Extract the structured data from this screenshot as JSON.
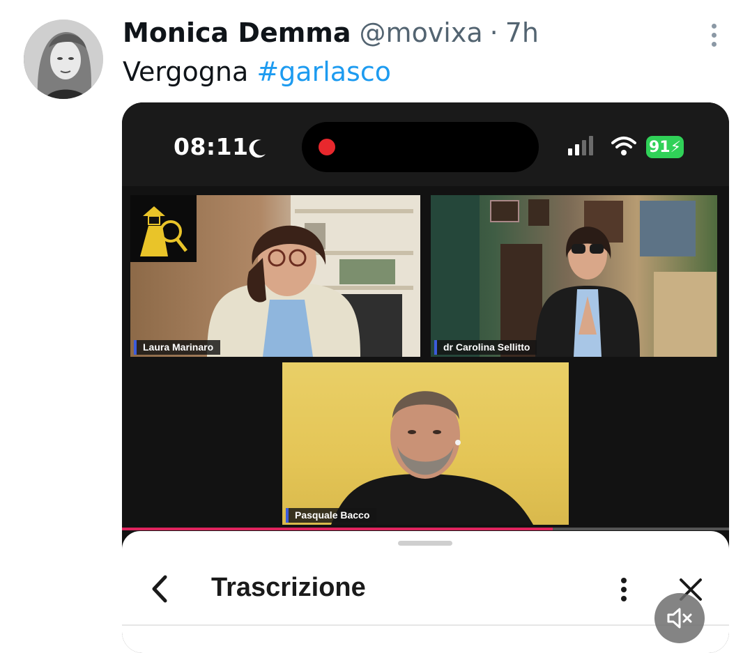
{
  "tweet": {
    "author_name": "Monica Demma",
    "author_handle": "@movixa",
    "separator": "·",
    "time": "7h",
    "text_plain": "Vergogna",
    "hashtag": "#garlasco"
  },
  "video": {
    "status_bar": {
      "clock": "08:11",
      "battery": "91"
    },
    "participants": [
      {
        "name": "Laura Marinaro"
      },
      {
        "name": "dr Carolina Sellitto"
      },
      {
        "name": "Pasquale Bacco"
      }
    ],
    "progress_fraction": 0.71,
    "sheet": {
      "title": "Trascrizione"
    }
  },
  "icons": {
    "more": "more-vertical-icon",
    "moon": "moon-icon",
    "signal": "signal-icon",
    "wifi": "wifi-icon",
    "back": "chevron-left-icon",
    "kebab": "kebab-icon",
    "close": "close-icon",
    "mute": "speaker-muted-icon"
  },
  "colors": {
    "link": "#1d9bf0",
    "battery": "#30d158",
    "recording": "#e8282d",
    "progress": "#e0245e"
  }
}
